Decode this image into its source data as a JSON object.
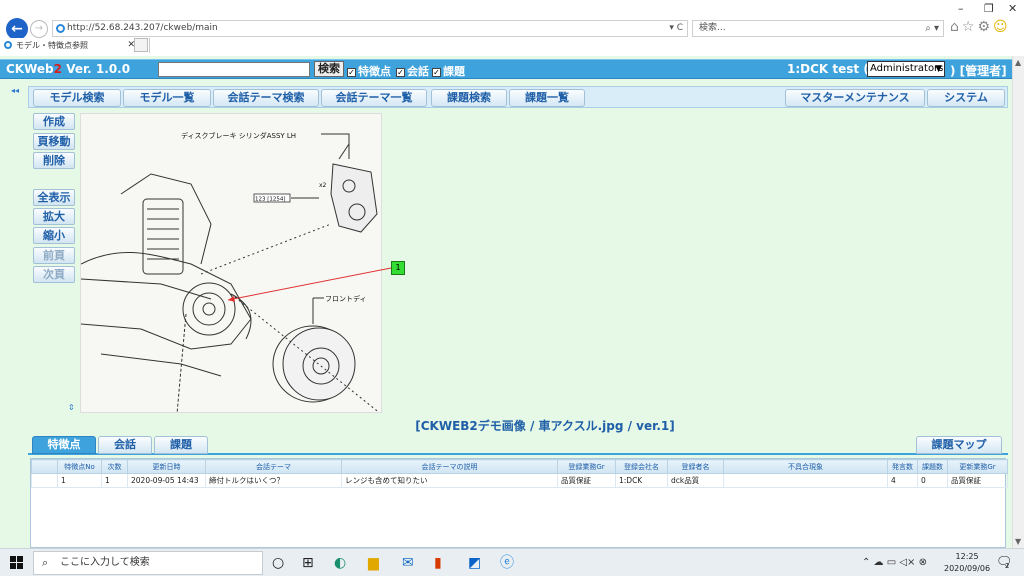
{
  "browser": {
    "url": "http://52.68.243.207/ckweb/main",
    "search_placeholder": "検索...",
    "tab_title": "モデル・特徴点参照",
    "minimize": "–",
    "maximize": "❐",
    "close": "✕",
    "addr_controls": "▾ C",
    "search_controls": "⌕ ▾"
  },
  "app": {
    "brand_prefix": "CKWeb",
    "brand_2": "2",
    "brand_version": " Ver. 1.0.0",
    "search_button": "検索",
    "checkboxes": [
      {
        "label": "特徴点",
        "checked": true
      },
      {
        "label": "会話",
        "checked": true
      },
      {
        "label": "課題",
        "checked": true
      }
    ],
    "user_label": "1:DCK  test  (",
    "role_selected": "Administrators",
    "user_tail": ") [管理者]"
  },
  "menu": {
    "items": [
      "モデル検索",
      "モデル一覧",
      "会話テーマ検索",
      "会話テーマ一覧",
      "課題検索",
      "課題一覧"
    ],
    "right_items": [
      "マスターメンテナンス",
      "システム"
    ]
  },
  "side_buttons": {
    "create": "作成",
    "move_page": "頁移動",
    "delete": "削除",
    "show_all": "全表示",
    "zoom_in": "拡大",
    "zoom_out": "縮小",
    "prev_page": "前頁",
    "next_page": "次頁"
  },
  "diagram": {
    "label_top": "ディスクブレーキ シリンダASSY LH",
    "part_no": "123 [1254]",
    "qty": "x2",
    "label_front": "フロントディ"
  },
  "marker_label": "1",
  "image_caption": "[CKWEB2デモ画像 / 車アクスル.jpg / ver.1]",
  "tabs": {
    "feature": "特徴点",
    "conversation": "会話",
    "issue": "課題",
    "issue_map": "課題マップ"
  },
  "grid": {
    "columns": [
      "",
      "特徴点No",
      "次数",
      "更新日時",
      "会話テーマ",
      "会話テーマの説明",
      "登録業務Gr",
      "登録会社名",
      "登録者名",
      "不具合現象",
      "発言数",
      "課題数",
      "更新業務Gr"
    ],
    "rows": [
      [
        "",
        "1",
        "1",
        "2020-09-05 14:43",
        "締付トルクはいくつ？",
        "レンジも含めて知りたい",
        "品質保証",
        "1:DCK",
        "dck品質",
        "",
        "4",
        "0",
        "品質保証"
      ]
    ]
  },
  "taskbar": {
    "search_text": "ここに入力して検索",
    "time": "12:25",
    "date": "2020/09/06",
    "notif_count": "2"
  },
  "colors": {
    "header_blue": "#3ea2dc",
    "app_bg": "#e6f8e6",
    "button_text": "#1f5fa8",
    "marker_green": "#33dd33",
    "leader_red": "#e03030"
  }
}
